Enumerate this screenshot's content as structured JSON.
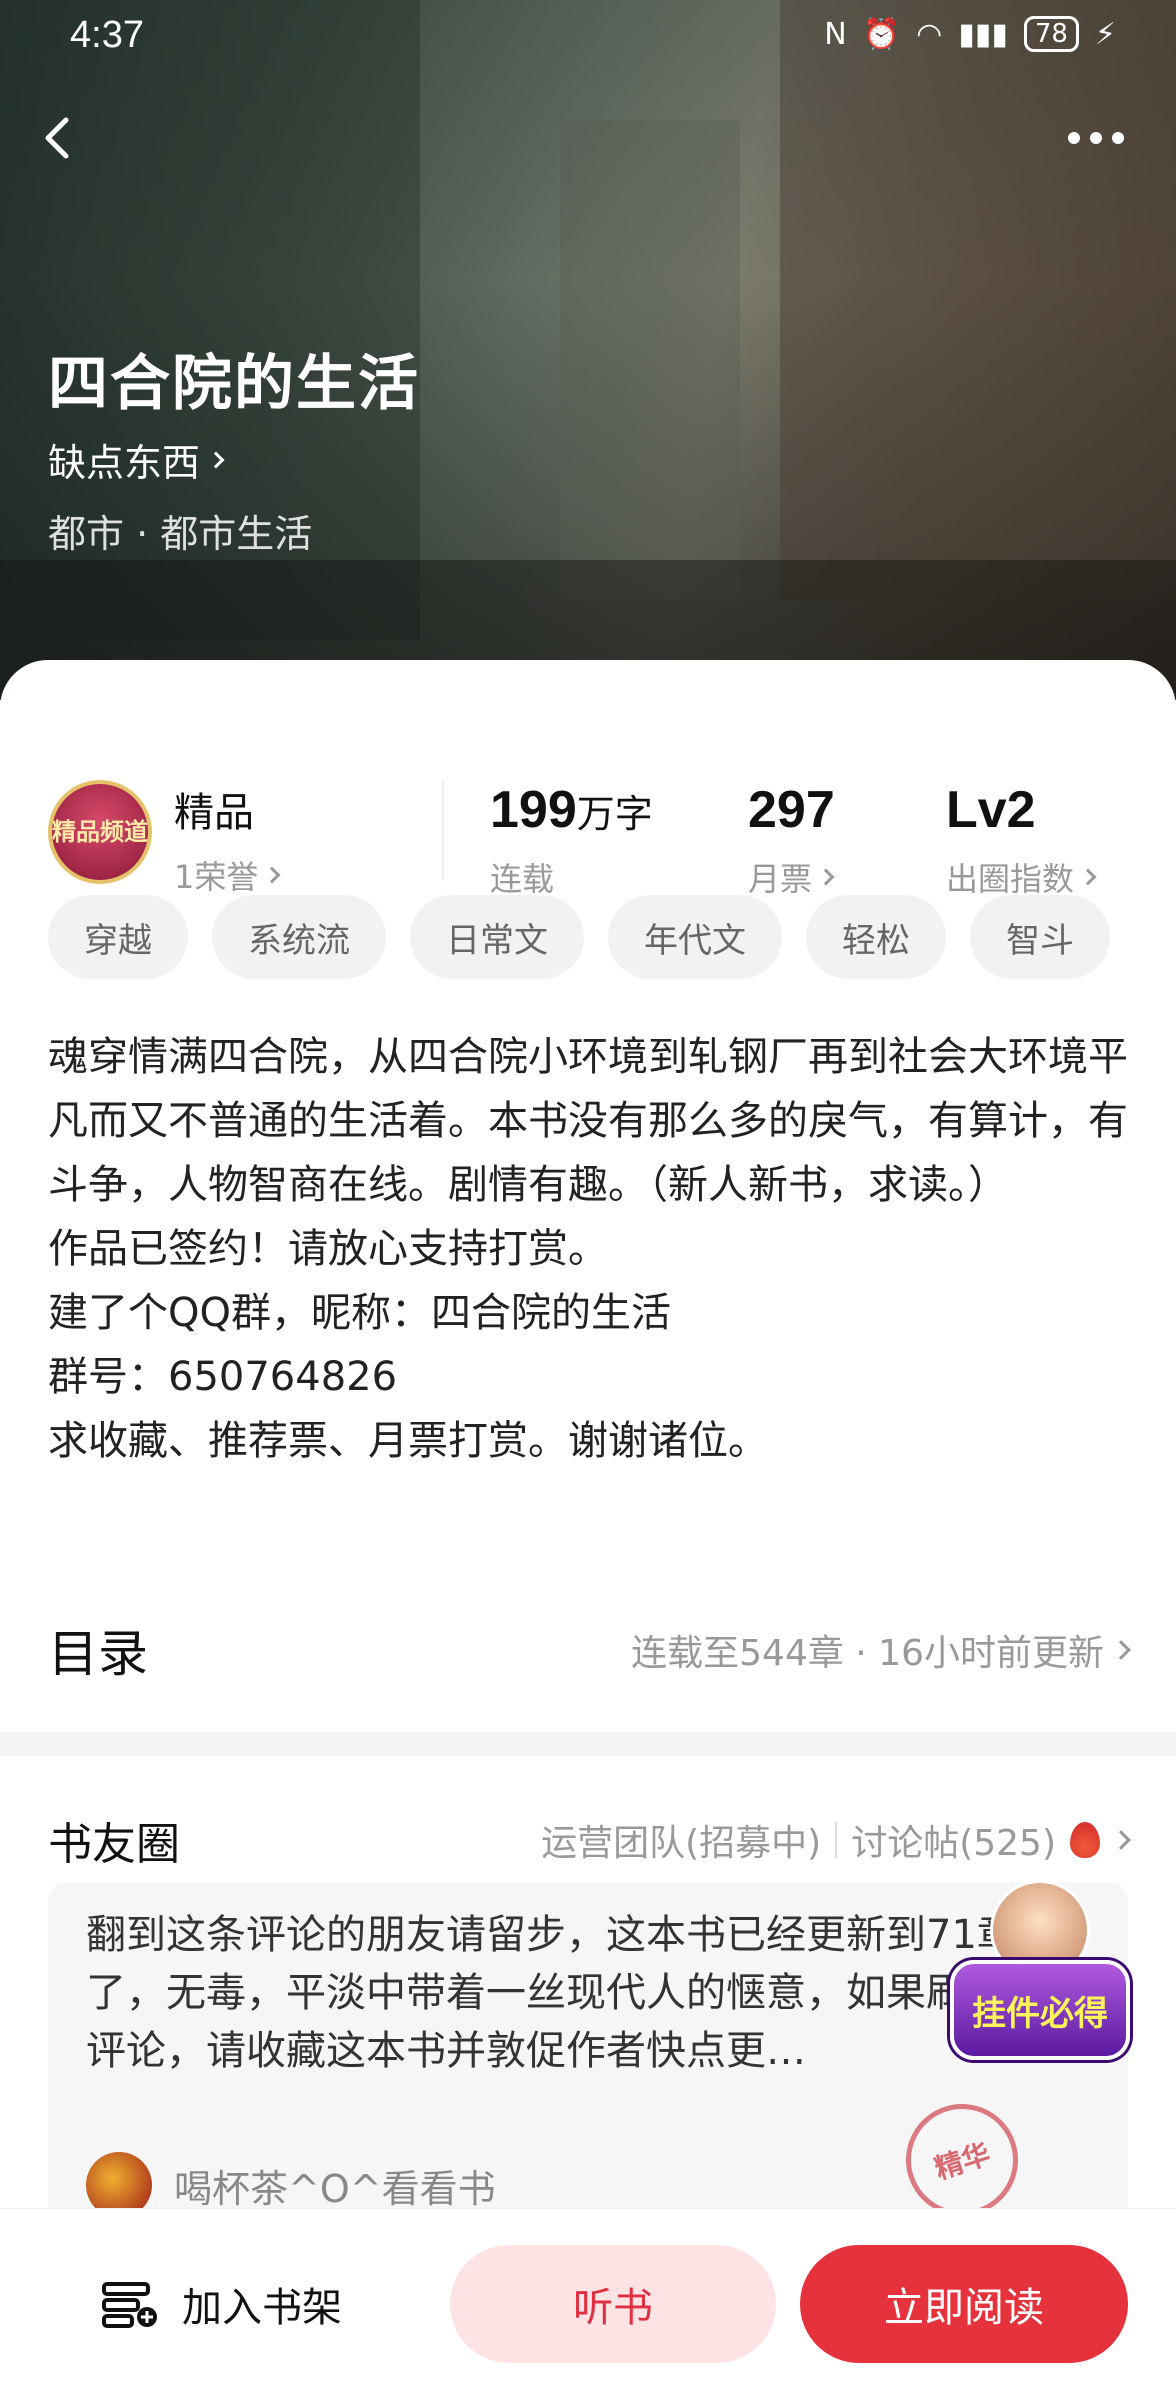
{
  "status_bar": {
    "time": "4:37",
    "battery": "78"
  },
  "book": {
    "title": "四合院的生活",
    "author": "缺点东西",
    "genre": "都市 · 都市生活"
  },
  "honor": {
    "badge": "精品",
    "sub": "1荣誉",
    "badge_text": "精品频道"
  },
  "stats": [
    {
      "value": "199",
      "unit": "万字",
      "label": "连载"
    },
    {
      "value": "297",
      "unit": "",
      "label": "月票"
    },
    {
      "value": "Lv2",
      "unit": "",
      "label": "出圈指数"
    }
  ],
  "tags": [
    "穿越",
    "系统流",
    "日常文",
    "年代文",
    "轻松",
    "智斗"
  ],
  "description": [
    "魂穿情满四合院，从四合院小环境到轧钢厂再到社会大环境平凡而又不普通的生活着。本书没有那么多的戾气，有算计，有斗争，人物智商在线。剧情有趣。（新人新书，求读。）",
    "作品已签约！请放心支持打赏。",
    "建了个QQ群，昵称：四合院的生活",
    "群号：650764826",
    "求收藏、推荐票、月票打赏。谢谢诸位。"
  ],
  "toc": {
    "title": "目录",
    "info": "连载至544章 · 16小时前更新"
  },
  "club": {
    "title": "书友圈",
    "ops": "运营团队(招募中)",
    "posts": "讨论帖(525)",
    "comment": "翻到这条评论的朋友请留步，这本书已经更新到71章了，无毒，平淡中带着一丝现代人的惬意，如果刷到这条评论，请收藏这本书并敦促作者快点更…",
    "user": "喝杯茶^O^看看书",
    "stamp": "精华"
  },
  "pendant": "挂件必得",
  "bottom": {
    "shelf": "加入书架",
    "listen": "听书",
    "read": "立即阅读"
  }
}
